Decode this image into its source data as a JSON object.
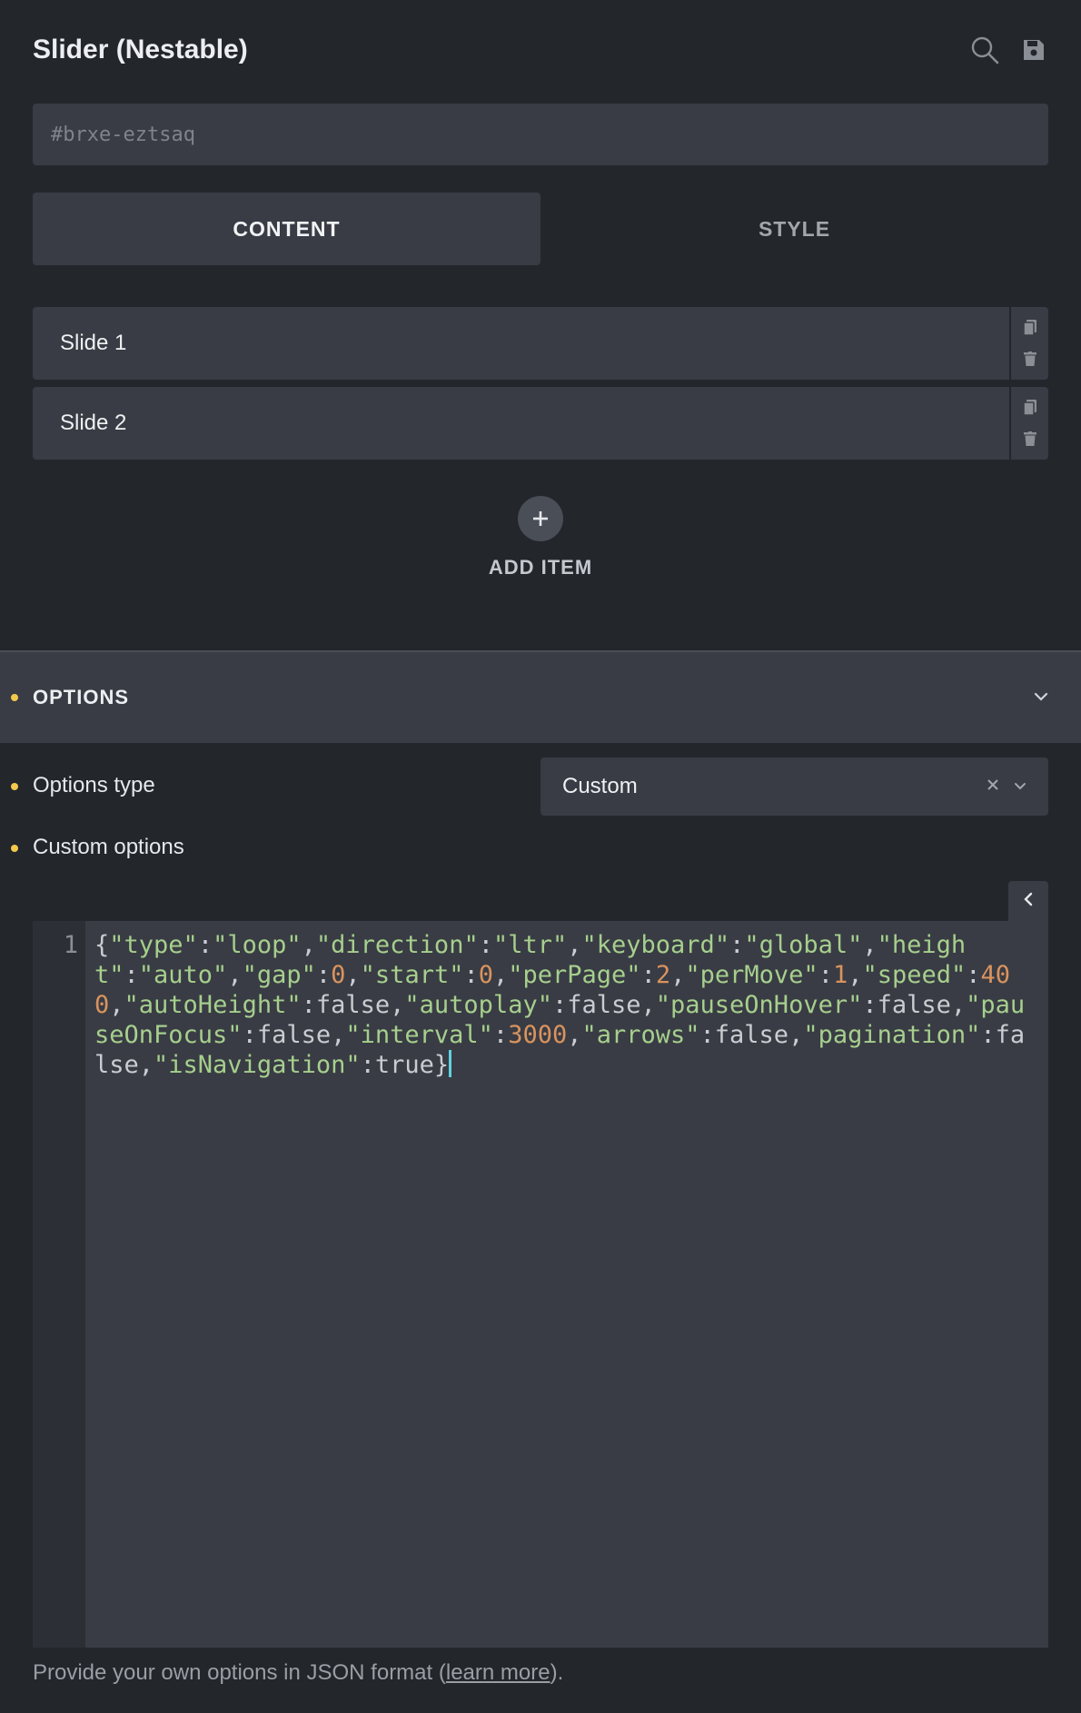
{
  "header": {
    "title": "Slider (Nestable)",
    "search_icon": "search-icon",
    "save_icon": "save-icon"
  },
  "id_field": {
    "placeholder": "#brxe-eztsaq"
  },
  "tabs": [
    {
      "label": "CONTENT",
      "active": true
    },
    {
      "label": "STYLE",
      "active": false
    }
  ],
  "slides": [
    {
      "label": "Slide 1"
    },
    {
      "label": "Slide 2"
    }
  ],
  "add_item": {
    "label": "ADD ITEM"
  },
  "options": {
    "title": "OPTIONS",
    "type_label": "Options type",
    "type_value": "Custom",
    "custom_label": "Custom options",
    "line_number": "1",
    "code": "{\"type\":\"loop\",\"direction\":\"ltr\",\"keyboard\":\"global\",\"height\":\"auto\",\"gap\":0,\"start\":0,\"perPage\":2,\"perMove\":1,\"speed\":400,\"autoHeight\":false,\"autoplay\":false,\"pauseOnHover\":false,\"pauseOnFocus\":false,\"interval\":3000,\"arrows\":false,\"pagination\":false,\"isNavigation\":true}",
    "help_prefix": "Provide your own options in JSON format (",
    "help_link": "learn more",
    "help_suffix": ")."
  },
  "colors": {
    "accent_dot": "#f2c94c",
    "string": "#a6cf8d",
    "number": "#d9935e",
    "caret": "#61d1e0"
  }
}
